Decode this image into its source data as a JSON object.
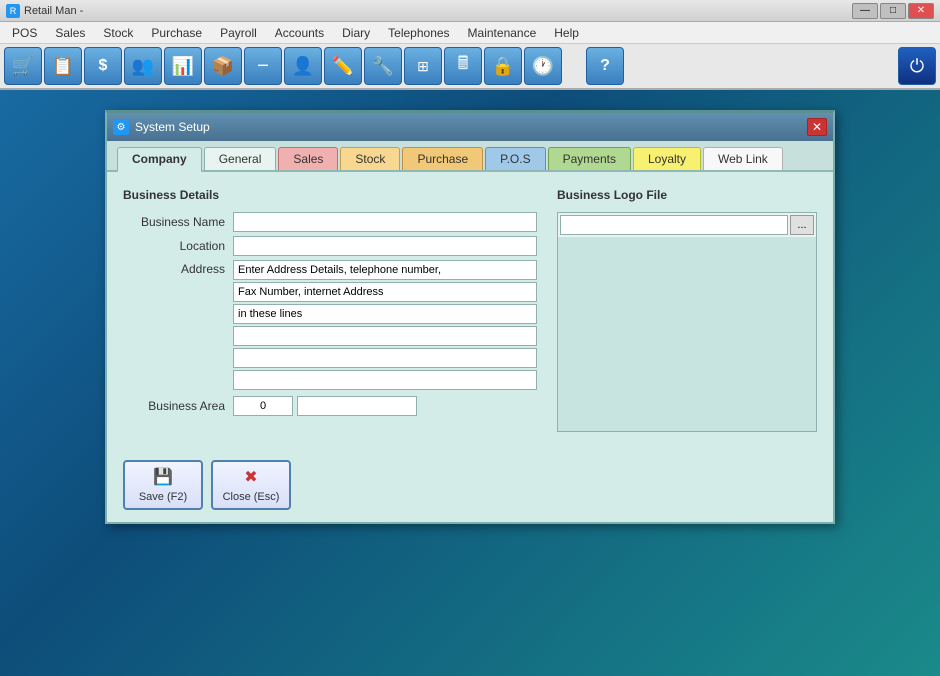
{
  "app": {
    "title": "Retail Man -",
    "icon": "R"
  },
  "titlebar": {
    "minimize_label": "—",
    "maximize_label": "□",
    "close_label": "✕"
  },
  "menubar": {
    "items": [
      "POS",
      "Sales",
      "Stock",
      "Purchase",
      "Payroll",
      "Accounts",
      "Diary",
      "Telephones",
      "Maintenance",
      "Help"
    ]
  },
  "toolbar": {
    "buttons": [
      {
        "name": "pos-icon",
        "icon": "🛒"
      },
      {
        "name": "document-icon",
        "icon": "📄"
      },
      {
        "name": "dollar-icon",
        "icon": "$"
      },
      {
        "name": "people-icon",
        "icon": "👥"
      },
      {
        "name": "chart-icon",
        "icon": "📊"
      },
      {
        "name": "box-icon",
        "icon": "📦"
      },
      {
        "name": "minus-icon",
        "icon": "➖"
      },
      {
        "name": "person-icon",
        "icon": "👤"
      },
      {
        "name": "edit-icon",
        "icon": "✏️"
      },
      {
        "name": "tools-icon",
        "icon": "🔧"
      },
      {
        "name": "grid-icon",
        "icon": "⊞"
      },
      {
        "name": "calc-icon",
        "icon": "🖩"
      },
      {
        "name": "lock-icon",
        "icon": "🔒"
      },
      {
        "name": "clock-icon",
        "icon": "🕐"
      },
      {
        "name": "help-icon",
        "icon": "?"
      },
      {
        "name": "power-icon",
        "icon": "⏻"
      }
    ]
  },
  "dialog": {
    "title": "System Setup",
    "icon": "⚙",
    "tabs": [
      {
        "label": "Company",
        "active": true,
        "color": "active"
      },
      {
        "label": "General",
        "color": ""
      },
      {
        "label": "Sales",
        "color": "red"
      },
      {
        "label": "Stock",
        "color": "orange"
      },
      {
        "label": "Purchase",
        "color": "orange2"
      },
      {
        "label": "P.O.S",
        "color": "blue"
      },
      {
        "label": "Payments",
        "color": "green"
      },
      {
        "label": "Loyalty",
        "color": "yellow"
      },
      {
        "label": "Web Link",
        "color": "white"
      }
    ],
    "sections": {
      "business_details": "Business Details",
      "business_logo": "Business Logo File"
    },
    "form": {
      "business_name_label": "Business Name",
      "business_name_value": "",
      "location_label": "Location",
      "location_value": "",
      "address_label": "Address",
      "address_lines": [
        "Enter Address Details, telephone number,",
        "Fax Number, internet Address",
        "in these lines",
        "",
        "",
        ""
      ],
      "business_area_label": "Business Area",
      "business_area_value": "0",
      "business_area_extra": ""
    },
    "logo": {
      "path_value": "",
      "browse_label": "..."
    },
    "buttons": {
      "save_label": "Save (F2)",
      "close_label": "Close (Esc)"
    }
  }
}
